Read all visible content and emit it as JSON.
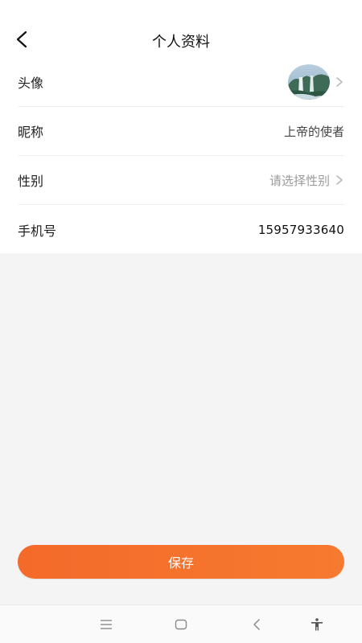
{
  "header": {
    "title": "个人资料"
  },
  "profile": {
    "avatar_label": "头像",
    "nickname_label": "昵称",
    "nickname_value": "上帝的使者",
    "gender_label": "性别",
    "gender_placeholder": "请选择性别",
    "phone_label": "手机号",
    "phone_value": "15957933640"
  },
  "actions": {
    "save_label": "保存"
  },
  "icons": {
    "back": "chevron-left-icon",
    "chevron": "chevron-right-icon",
    "nav_menu": "menu-icon",
    "nav_home": "home-square-icon",
    "nav_back": "back-triangle-icon",
    "nav_accessibility": "accessibility-icon"
  },
  "colors": {
    "accent": "#f46a2a",
    "background": "#f5f4f4",
    "card": "#ffffff"
  }
}
